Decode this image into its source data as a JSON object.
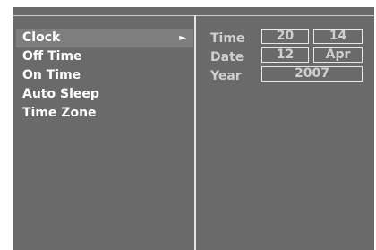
{
  "menu": {
    "items": [
      {
        "label": "Clock",
        "arrow": "►",
        "selected": true
      },
      {
        "label": "Off Time"
      },
      {
        "label": "On Time"
      },
      {
        "label": "Auto Sleep"
      },
      {
        "label": "Time Zone"
      }
    ]
  },
  "clock": {
    "time_label": "Time",
    "hour": "20",
    "minute": "14",
    "date_label": "Date",
    "day": "12",
    "month": "Apr",
    "year_label": "Year",
    "year": "2007"
  },
  "colors": {
    "panel_bg": "#6a6a6a",
    "selected_bg": "#7e7e7e",
    "menu_text": "#ffffff",
    "value_text": "#cfcfcf",
    "divider": "#e6e6e6"
  }
}
